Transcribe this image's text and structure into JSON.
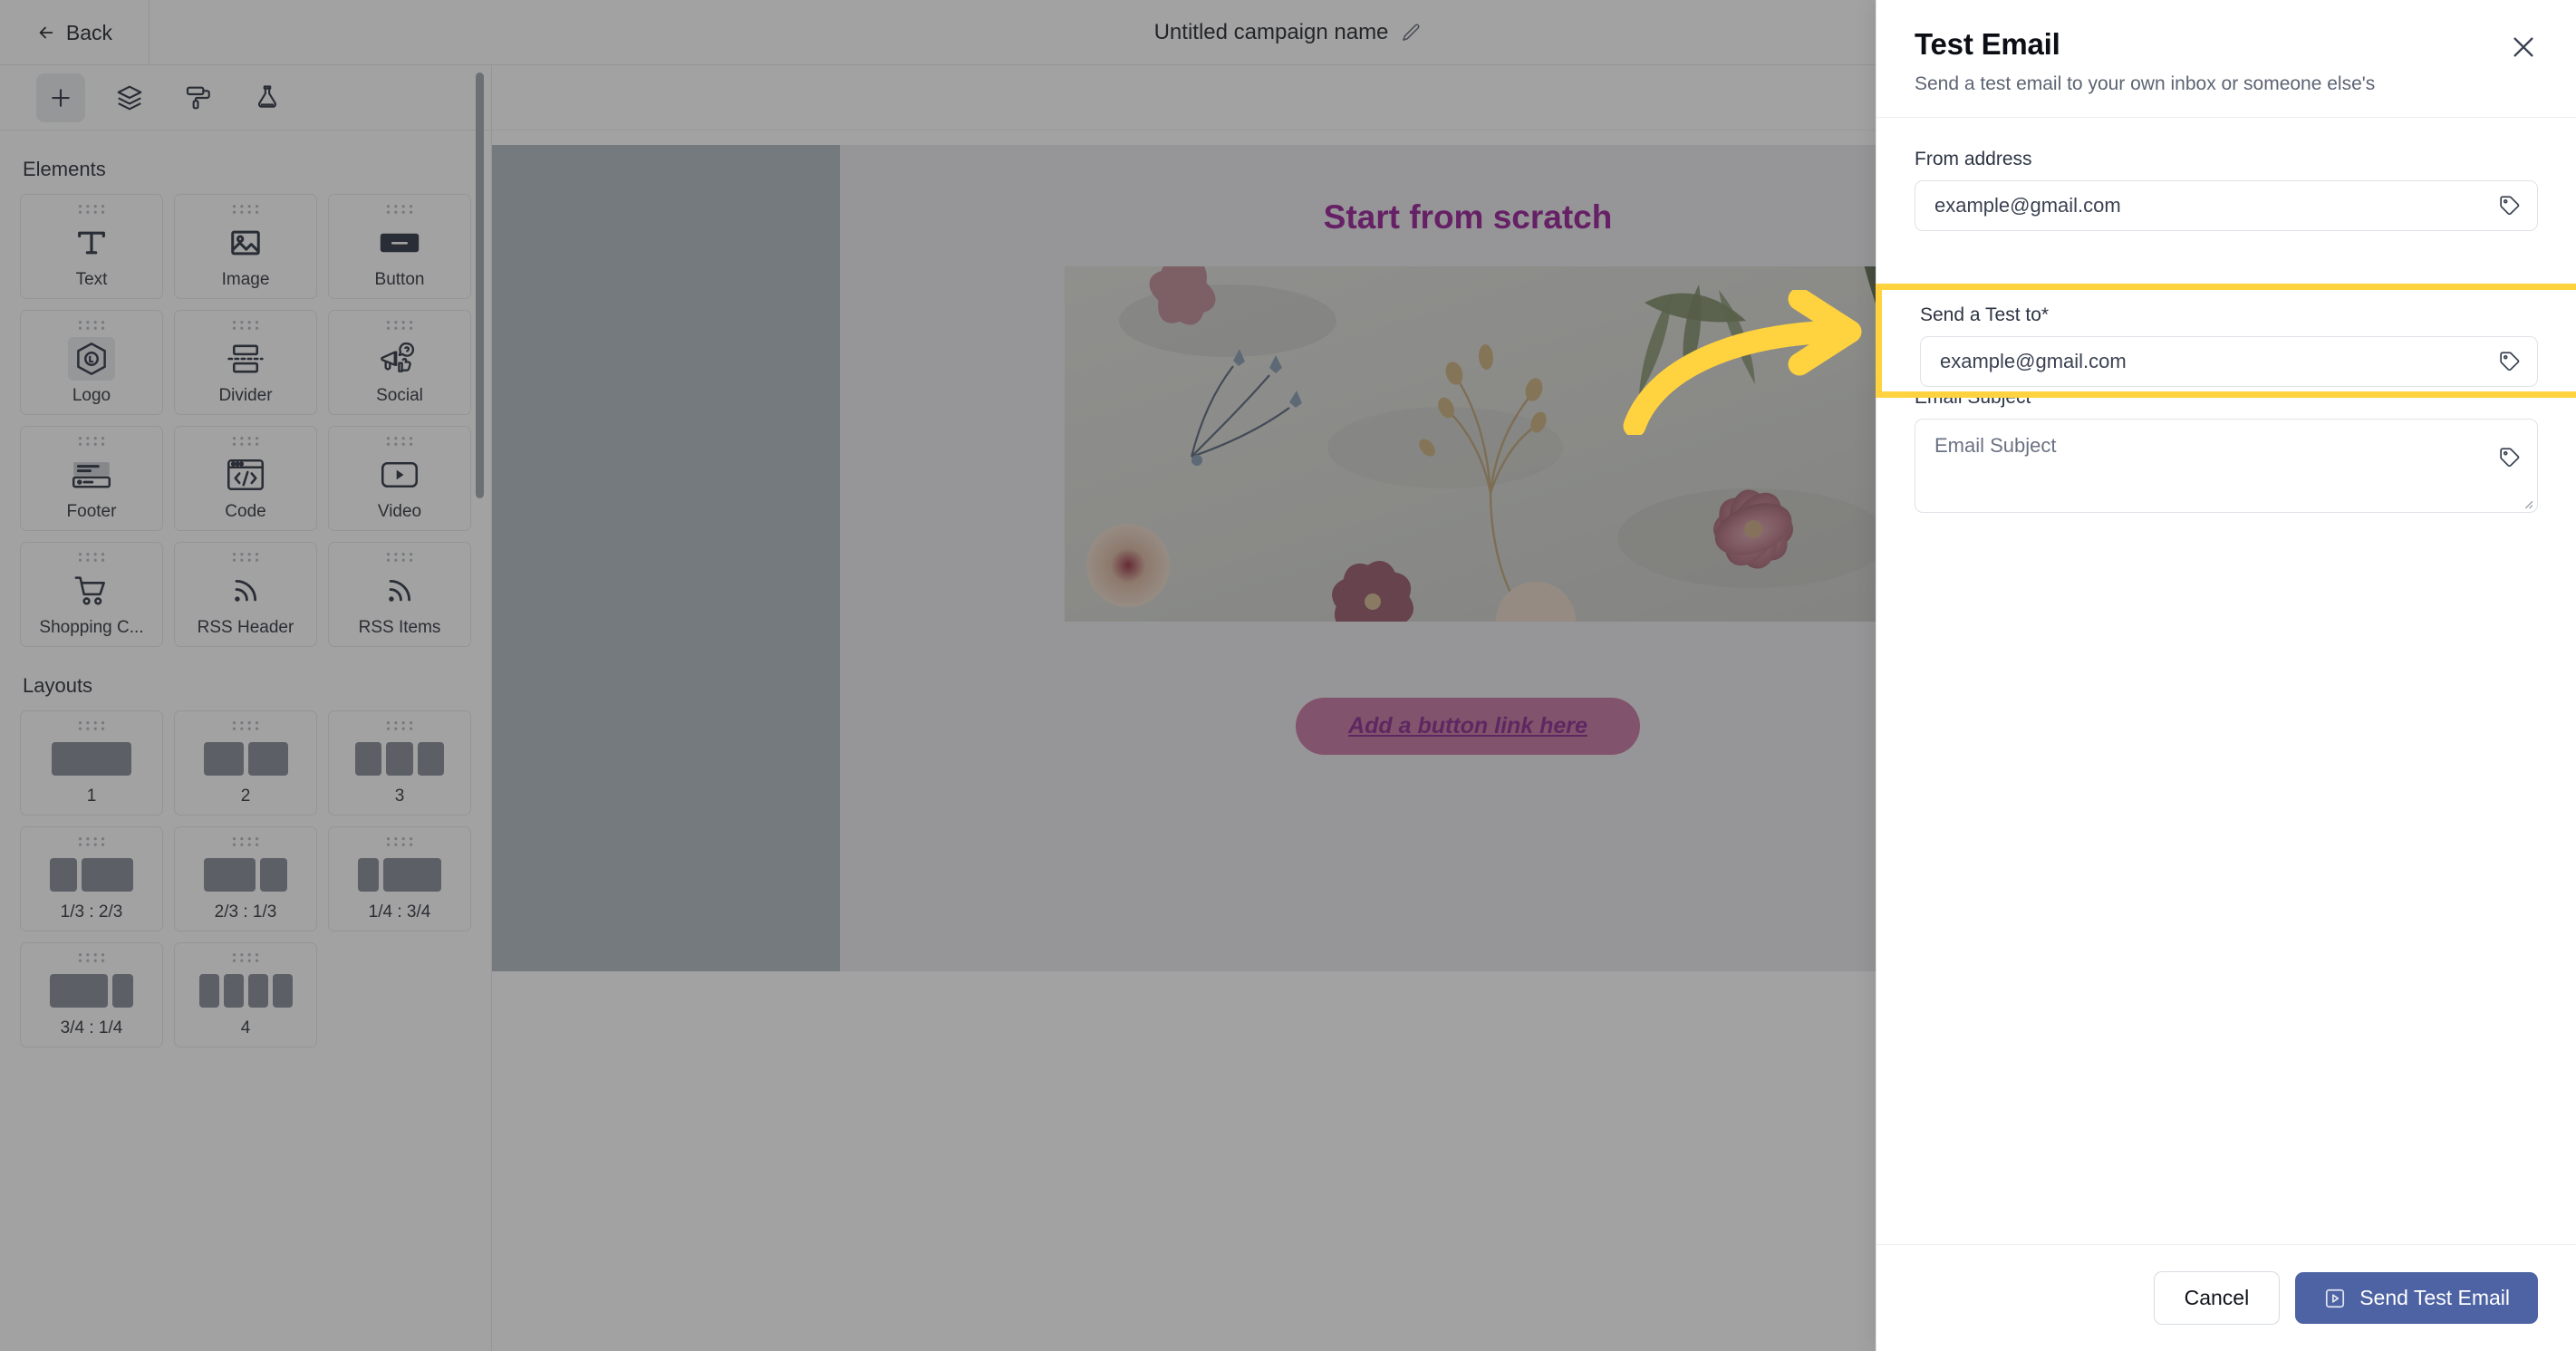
{
  "topbar": {
    "back_label": "Back",
    "back_icon": "arrow-left-icon",
    "campaign_title": "Untitled campaign name",
    "edit_icon": "pencil-icon"
  },
  "sidebar": {
    "tools": [
      {
        "name": "add-block-tool",
        "icon": "plus-icon",
        "active": true
      },
      {
        "name": "layers-tool",
        "icon": "layers-icon",
        "active": false
      },
      {
        "name": "styles-tool",
        "icon": "paint-roller-icon",
        "active": false
      },
      {
        "name": "theme-tool",
        "icon": "flask-icon",
        "active": false
      }
    ],
    "elements_title": "Elements",
    "elements": [
      {
        "label": "Text",
        "icon": "text-t-icon"
      },
      {
        "label": "Image",
        "icon": "image-icon"
      },
      {
        "label": "Button",
        "icon": "button-icon"
      },
      {
        "label": "Logo",
        "icon": "logo-hex-icon"
      },
      {
        "label": "Divider",
        "icon": "divider-icon"
      },
      {
        "label": "Social",
        "icon": "social-megaphone-icon"
      },
      {
        "label": "Footer",
        "icon": "footer-icon"
      },
      {
        "label": "Code",
        "icon": "code-window-icon"
      },
      {
        "label": "Video",
        "icon": "video-play-icon"
      },
      {
        "label": "Shopping C...",
        "icon": "shopping-cart-icon"
      },
      {
        "label": "RSS Header",
        "icon": "rss-icon"
      },
      {
        "label": "RSS Items",
        "icon": "rss-icon"
      }
    ],
    "layouts_title": "Layouts",
    "layouts": [
      {
        "label": "1",
        "cols": [
          100
        ]
      },
      {
        "label": "2",
        "cols": [
          50,
          50
        ]
      },
      {
        "label": "3",
        "cols": [
          33,
          33,
          33
        ]
      },
      {
        "label": "1/3 : 2/3",
        "cols": [
          33,
          62
        ]
      },
      {
        "label": "2/3 : 1/3",
        "cols": [
          62,
          33
        ]
      },
      {
        "label": "1/4 : 3/4",
        "cols": [
          26,
          70
        ]
      },
      {
        "label": "3/4 : 1/4",
        "cols": [
          70,
          26
        ]
      },
      {
        "label": "4",
        "cols": [
          24,
          24,
          24,
          24
        ]
      }
    ]
  },
  "canvas": {
    "email_title": "Start from scratch",
    "email_title_color": "#8e0b8e",
    "cta_label": "Add a button link here",
    "cta_bg": "#c26b99",
    "cta_text_color": "#7d1a85",
    "photo_alt": "dried-flowers-flatlay-photo"
  },
  "panel": {
    "title": "Test Email",
    "subtitle": "Send a test email to your own inbox or someone else's",
    "close_icon": "close-icon",
    "from_address": {
      "label": "From address",
      "value": "example@gmail.com",
      "tag_icon": "tag-icon"
    },
    "send_test_to": {
      "label": "Send a Test to*",
      "value": "example@gmail.com",
      "tag_icon": "tag-icon",
      "highlight_color": "#ffd23f"
    },
    "email_subject": {
      "label": "Email Subject",
      "placeholder": "Email Subject",
      "tag_icon": "tag-icon"
    },
    "footer": {
      "cancel_label": "Cancel",
      "send_label": "Send Test Email",
      "send_icon": "send-play-icon",
      "send_bg": "#4e63a4"
    }
  },
  "annotation": {
    "arrow_color": "#ffd23f",
    "arrow_name": "pointer-arrow-annotation"
  }
}
